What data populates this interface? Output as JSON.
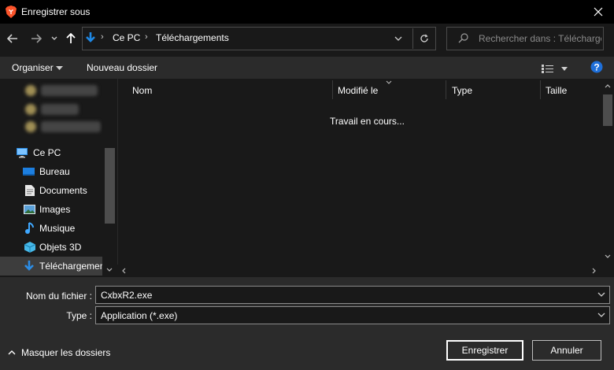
{
  "window": {
    "title": "Enregistrer sous",
    "close_icon": "close-icon"
  },
  "nav": {
    "back_icon": "back-arrow-icon",
    "forward_icon": "forward-arrow-icon",
    "recent_icon": "chevron-down-icon",
    "up_icon": "up-arrow-icon",
    "breadcrumb": [
      "Ce PC",
      "Téléchargements"
    ],
    "refresh_icon": "refresh-icon",
    "search_placeholder": "Rechercher dans : Téléchargements"
  },
  "toolbar": {
    "organize_label": "Organiser",
    "new_folder_label": "Nouveau dossier",
    "view_icon": "view-options-icon",
    "help_icon": "help-icon"
  },
  "sidebar": {
    "items": [
      {
        "label": "Ce PC",
        "icon": "computer-icon"
      },
      {
        "label": "Bureau",
        "icon": "desktop-icon"
      },
      {
        "label": "Documents",
        "icon": "documents-icon"
      },
      {
        "label": "Images",
        "icon": "images-icon"
      },
      {
        "label": "Musique",
        "icon": "music-icon"
      },
      {
        "label": "Objets 3D",
        "icon": "objects-3d-icon"
      },
      {
        "label": "Téléchargements",
        "icon": "download-icon"
      }
    ]
  },
  "filelist": {
    "columns": [
      "Nom",
      "Modifié le",
      "Type",
      "Taille"
    ],
    "status": "Travail en cours..."
  },
  "form": {
    "filename_label": "Nom du fichier :",
    "filename_value": "CxbxR2.exe",
    "type_label": "Type :",
    "type_value": "Application (*.exe)"
  },
  "footer": {
    "hide_folders_label": "Masquer les dossiers",
    "save_label": "Enregistrer",
    "cancel_label": "Annuler"
  },
  "colors": {
    "accent_blue": "#1e88e5",
    "brave_orange": "#fb542b"
  }
}
